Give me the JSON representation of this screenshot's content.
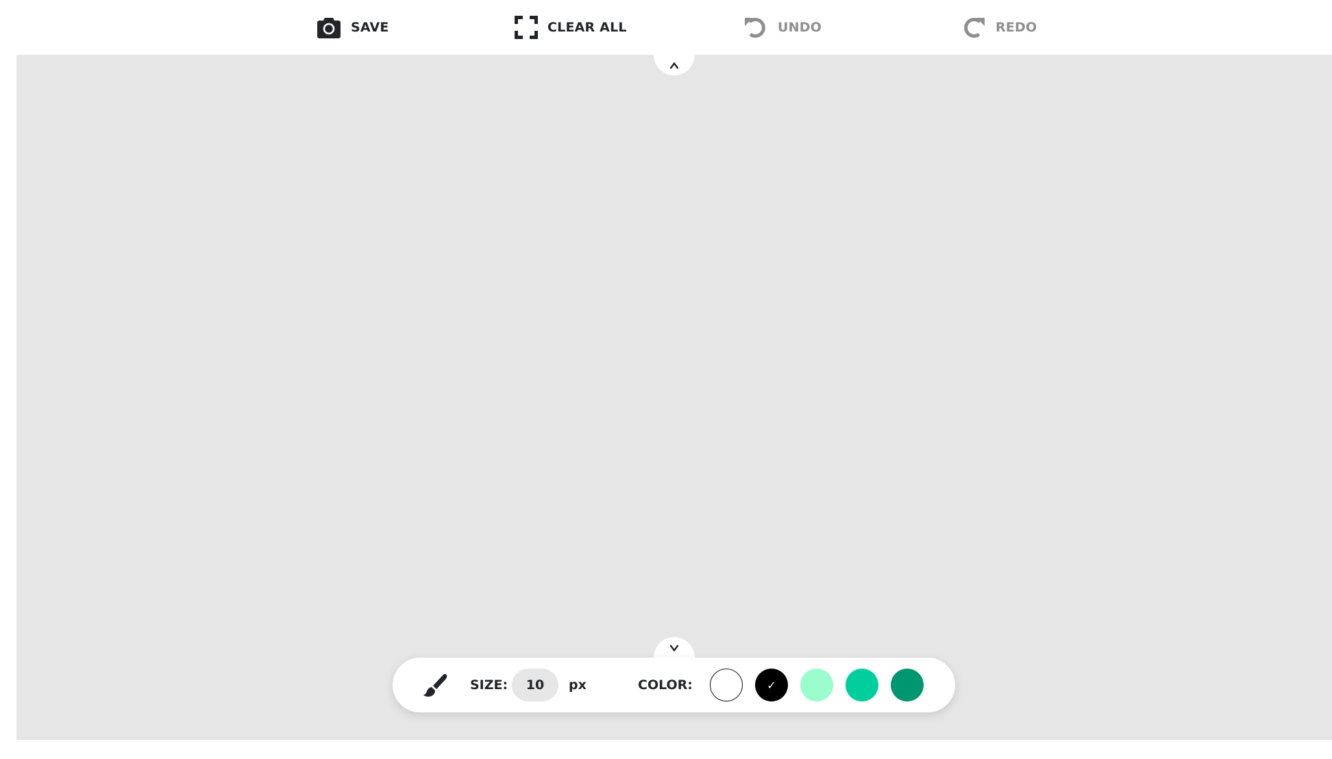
{
  "toolbar": {
    "save": {
      "label": "SAVE",
      "icon": "camera-icon",
      "enabled": true
    },
    "clear_all": {
      "label": "CLEAR ALL",
      "icon": "fullscreen-corners-icon",
      "enabled": true
    },
    "undo": {
      "label": "UNDO",
      "icon": "undo-icon",
      "enabled": false
    },
    "redo": {
      "label": "REDO",
      "icon": "redo-icon",
      "enabled": false
    }
  },
  "canvas": {
    "background": "#e6e6e6",
    "collapse_top_glyph": "^",
    "collapse_bottom_glyph": "v"
  },
  "brush_panel": {
    "tool_icon": "paintbrush-icon",
    "size_label": "SIZE:",
    "size_value": "10",
    "size_unit": "px",
    "color_label": "COLOR:",
    "selected_mark": "✓",
    "colors": [
      {
        "name": "white",
        "hex": "#ffffff",
        "selected": false
      },
      {
        "name": "black",
        "hex": "#000000",
        "selected": true
      },
      {
        "name": "mint",
        "hex": "#9bfccd",
        "selected": false
      },
      {
        "name": "teal",
        "hex": "#00ce9c",
        "selected": false
      },
      {
        "name": "dark-green",
        "hex": "#009670",
        "selected": false
      }
    ]
  }
}
